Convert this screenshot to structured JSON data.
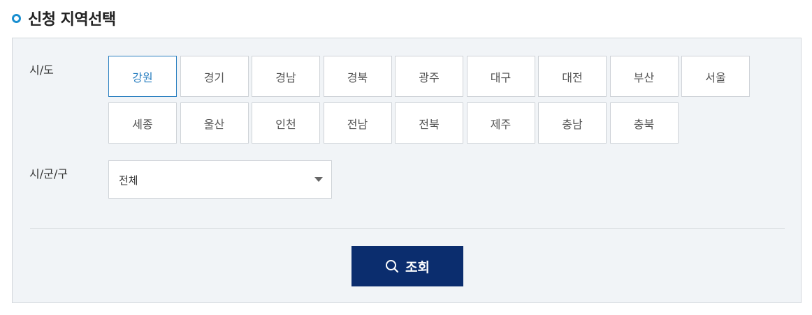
{
  "header": {
    "title": "신청 지역선택"
  },
  "filters": {
    "sido_label": "시/도",
    "sigungu_label": "시/군/구",
    "regions": [
      {
        "id": "gangwon",
        "label": "강원",
        "selected": true
      },
      {
        "id": "gyeonggi",
        "label": "경기",
        "selected": false
      },
      {
        "id": "gyeongnam",
        "label": "경남",
        "selected": false
      },
      {
        "id": "gyeongbuk",
        "label": "경북",
        "selected": false
      },
      {
        "id": "gwangju",
        "label": "광주",
        "selected": false
      },
      {
        "id": "daegu",
        "label": "대구",
        "selected": false
      },
      {
        "id": "daejeon",
        "label": "대전",
        "selected": false
      },
      {
        "id": "busan",
        "label": "부산",
        "selected": false
      },
      {
        "id": "seoul",
        "label": "서울",
        "selected": false
      },
      {
        "id": "sejong",
        "label": "세종",
        "selected": false
      },
      {
        "id": "ulsan",
        "label": "울산",
        "selected": false
      },
      {
        "id": "incheon",
        "label": "인천",
        "selected": false
      },
      {
        "id": "jeonnam",
        "label": "전남",
        "selected": false
      },
      {
        "id": "jeonbuk",
        "label": "전북",
        "selected": false
      },
      {
        "id": "jeju",
        "label": "제주",
        "selected": false
      },
      {
        "id": "chungnam",
        "label": "충남",
        "selected": false
      },
      {
        "id": "chungbuk",
        "label": "충북",
        "selected": false
      }
    ],
    "sigungu_select": {
      "value": "전체"
    }
  },
  "actions": {
    "search_label": "조회"
  },
  "colors": {
    "accent": "#1a8fd0",
    "selected": "#2a7fc0",
    "button_bg": "#0b2d6e",
    "panel_bg": "#f1f4f7"
  },
  "icons": {
    "title_bullet": "circle-bullet-icon",
    "search": "search-icon",
    "dropdown": "caret-down-icon"
  }
}
